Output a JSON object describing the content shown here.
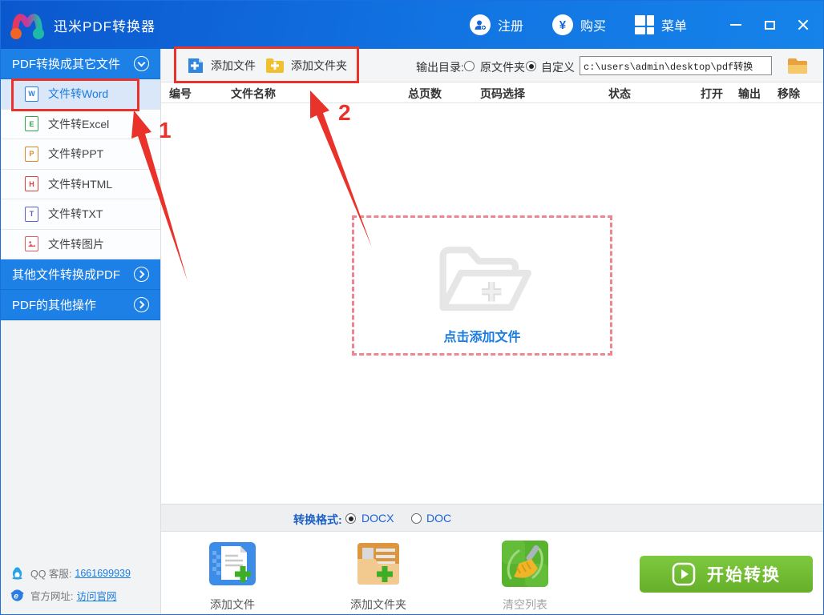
{
  "app": {
    "title": "迅米PDF转换器"
  },
  "titlebar": {
    "register_label": "注册",
    "buy_label": "购买",
    "menu_label": "菜单"
  },
  "sidebar": {
    "section1": {
      "label": "PDF转换成其它文件",
      "state": "expanded"
    },
    "items": [
      {
        "label": "文件转Word",
        "letter": "W",
        "color": "#2e7fe0",
        "selected": true
      },
      {
        "label": "文件转Excel",
        "letter": "E",
        "color": "#34a546",
        "selected": false
      },
      {
        "label": "文件转PPT",
        "letter": "P",
        "color": "#d8882a",
        "selected": false
      },
      {
        "label": "文件转HTML",
        "letter": "H",
        "color": "#d8443c",
        "selected": false
      },
      {
        "label": "文件转TXT",
        "letter": "T",
        "color": "#5b5fc7",
        "selected": false
      },
      {
        "label": "文件转图片",
        "letter": "",
        "color": "#e05a62",
        "icon": "image-icon",
        "selected": false
      }
    ],
    "section2": {
      "label": "其他文件转换成PDF",
      "state": "collapsed"
    },
    "section3": {
      "label": "PDF的其他操作",
      "state": "collapsed"
    },
    "footer": {
      "qq_label": "QQ 客服:",
      "qq_link": "1661699939",
      "site_label": "官方网址:",
      "site_link": "访问官网"
    }
  },
  "toolbar": {
    "add_file": "添加文件",
    "add_folder": "添加文件夹",
    "output_label": "输出目录:",
    "radio_original": "原文件夹",
    "radio_custom": "自定义",
    "radio_selected": "自定义",
    "output_path": "c:\\users\\admin\\desktop\\pdf转换"
  },
  "table": {
    "headers": [
      "编号",
      "文件名称",
      "总页数",
      "页码选择",
      "状态",
      "打开",
      "输出",
      "移除"
    ]
  },
  "dropzone": {
    "label": "点击添加文件"
  },
  "format_bar": {
    "label": "转换格式:",
    "options": [
      "DOCX",
      "DOC"
    ],
    "selected": "DOCX"
  },
  "bottom": {
    "add_file": "添加文件",
    "add_folder": "添加文件夹",
    "clear_list": "清空列表",
    "start": "开始转换"
  },
  "annotations": {
    "step1": "1",
    "step2": "2"
  },
  "colors": {
    "accent_blue": "#1a7ce0",
    "titlebar_gradient_start": "#0b57ce",
    "titlebar_gradient_end": "#1583ea",
    "sidebar_header_blue": "#1d80e6",
    "selected_item_bg": "#d9e7f8",
    "annotation_red": "#e9332a",
    "dropzone_dash_pink": "#ef8492",
    "start_button_green": "#6fbe33",
    "add_file_icon_blue": "#3d8de8",
    "add_folder_icon_orange": "#eda73f",
    "clear_icon_green": "#57b32d"
  }
}
